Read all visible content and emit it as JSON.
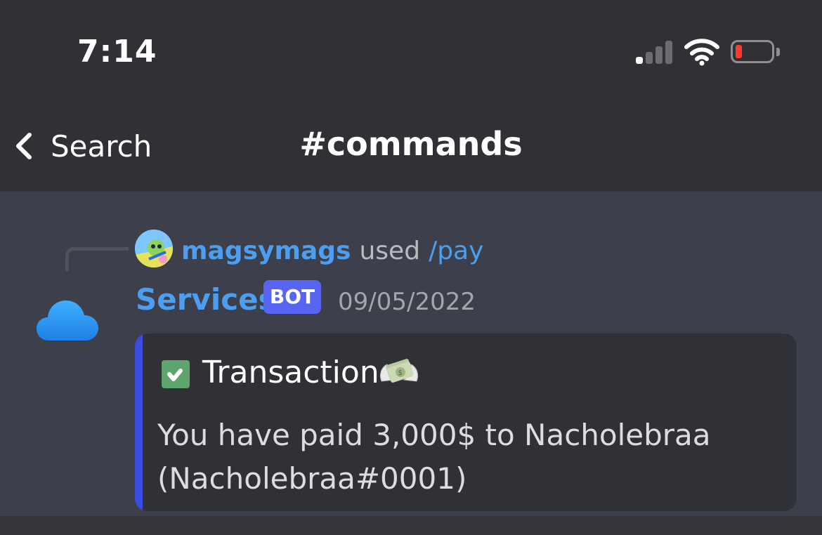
{
  "status_bar": {
    "time": "7:14",
    "signal_icon": "cellular-signal-icon",
    "wifi_icon": "wifi-icon",
    "battery_icon": "battery-low-icon",
    "battery_level": 0.1,
    "battery_color": "#ff3b30"
  },
  "header": {
    "back_label": "Search",
    "channel_title": "#commands"
  },
  "message": {
    "reference": {
      "username": "magsymags",
      "used_text": "used",
      "command": "/pay"
    },
    "author": "Services",
    "bot_tag": "BOT",
    "timestamp": "09/05/2022",
    "avatar_icon": "cloud-icon",
    "embed": {
      "accent_color": "#3b4ce3",
      "icon": "check-card-icon",
      "title": "Transaction",
      "title_icon": "money-with-wings-icon",
      "description": "You have paid 3,000$ to Nacholebraa (Nacholebraa#0001)"
    }
  },
  "colors": {
    "username": "#4b9ef0",
    "bot_tag": "#5865f2"
  }
}
